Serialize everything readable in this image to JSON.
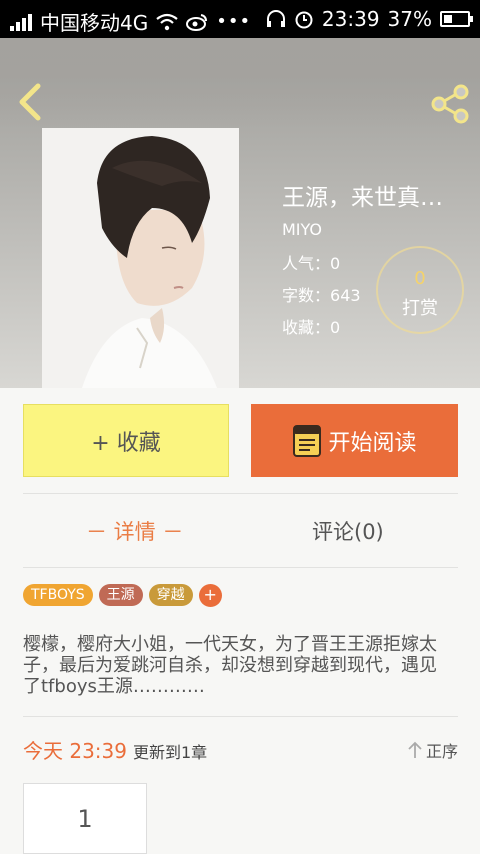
{
  "statusbar": {
    "carrier": "中国移动4G",
    "time": "23:39",
    "battery": "37%"
  },
  "book": {
    "title": "王源，来世真…",
    "author": "MIYO",
    "stats": [
      {
        "label": "人气：",
        "value": "0"
      },
      {
        "label": "字数：",
        "value": "643"
      },
      {
        "label": "收藏：",
        "value": "0"
      }
    ],
    "reward": {
      "count": "0",
      "label": "打赏"
    }
  },
  "actions": {
    "favorite_label": "+ 收藏",
    "read_label": "开始阅读"
  },
  "tabs": {
    "detail": "－ 详情 －",
    "comment": "评论(0)"
  },
  "tags": [
    {
      "label": "TFBOYS",
      "color": "#f0a531"
    },
    {
      "label": "王源",
      "color": "#c06a55"
    },
    {
      "label": "穿越",
      "color": "#c99a3a"
    }
  ],
  "tag_add": "+",
  "description": "樱檬，樱府大小姐，一代天女，为了晋王王源拒嫁太子，最后为爱跳河自杀，却没想到穿越到现代，遇见了tfboys王源…………",
  "update": {
    "time": "今天 23:39",
    "text": "更新到1章",
    "sort": "正序"
  },
  "chapters": [
    "1"
  ],
  "colors": {
    "accent": "#ea6d3a",
    "favorite_bg": "#fbf580",
    "reward_gold": "#f5d36a"
  },
  "icons": [
    "back-arrow-icon",
    "share-icon",
    "book-icon",
    "sort-up-arrow-icon"
  ]
}
